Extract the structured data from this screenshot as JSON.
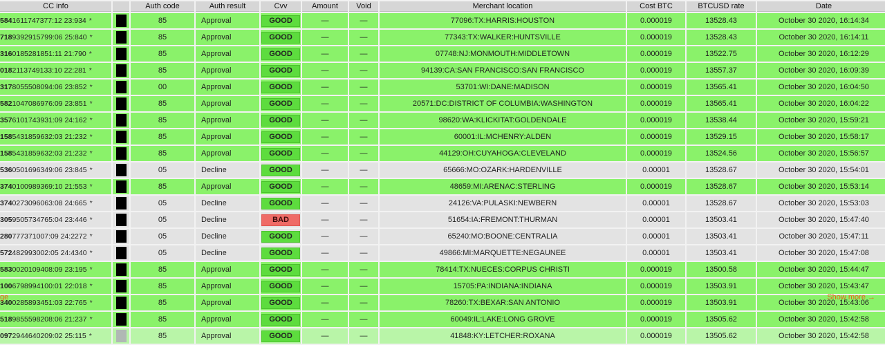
{
  "columns": [
    "CC info",
    "",
    "Auth code",
    "Auth result",
    "Cvv",
    "Amount",
    "Void",
    "Merchant location",
    "Cost BTC",
    "BTCUSD rate",
    "Date"
  ],
  "rows": [
    {
      "cc_prefix": "584",
      "cc_rest": "1611747377:12 23:934",
      "auth": "85",
      "result": "Approval",
      "cvv": "GOOD",
      "amount": "—",
      "void": "—",
      "location": "77096:TX:HARRIS:HOUSTON",
      "cost": "0.000019",
      "rate": "13528.43",
      "date": "October 30 2020, 16:14:34",
      "status": "ok"
    },
    {
      "cc_prefix": "718",
      "cc_rest": "9392915799:06 25:840",
      "auth": "85",
      "result": "Approval",
      "cvv": "GOOD",
      "amount": "—",
      "void": "—",
      "location": "77343:TX:WALKER:HUNTSVILLE",
      "cost": "0.000019",
      "rate": "13528.43",
      "date": "October 30 2020, 16:14:11",
      "status": "ok"
    },
    {
      "cc_prefix": "316",
      "cc_rest": "0185281851:11 21:790",
      "auth": "85",
      "result": "Approval",
      "cvv": "GOOD",
      "amount": "—",
      "void": "—",
      "location": "07748:NJ:MONMOUTH:MIDDLETOWN",
      "cost": "0.000019",
      "rate": "13522.75",
      "date": "October 30 2020, 16:12:29",
      "status": "ok"
    },
    {
      "cc_prefix": "018",
      "cc_rest": "2113749133:10 22:281",
      "auth": "85",
      "result": "Approval",
      "cvv": "GOOD",
      "amount": "—",
      "void": "—",
      "location": "94139:CA:SAN FRANCISCO:SAN FRANCISCO",
      "cost": "0.000019",
      "rate": "13557.37",
      "date": "October 30 2020, 16:09:39",
      "status": "ok"
    },
    {
      "cc_prefix": "317",
      "cc_rest": "8055508094:06 23:852",
      "auth": "00",
      "result": "Approval",
      "cvv": "GOOD",
      "amount": "—",
      "void": "—",
      "location": "53701:WI:DANE:MADISON",
      "cost": "0.000019",
      "rate": "13565.41",
      "date": "October 30 2020, 16:04:50",
      "status": "ok"
    },
    {
      "cc_prefix": "582",
      "cc_rest": "1047086976:09 23:851",
      "auth": "85",
      "result": "Approval",
      "cvv": "GOOD",
      "amount": "—",
      "void": "—",
      "location": "20571:DC:DISTRICT OF COLUMBIA:WASHINGTON",
      "cost": "0.000019",
      "rate": "13565.41",
      "date": "October 30 2020, 16:04:22",
      "status": "ok"
    },
    {
      "cc_prefix": "357",
      "cc_rest": "6101743931:09 24:162",
      "auth": "85",
      "result": "Approval",
      "cvv": "GOOD",
      "amount": "—",
      "void": "—",
      "location": "98620:WA:KLICKITAT:GOLDENDALE",
      "cost": "0.000019",
      "rate": "13538.44",
      "date": "October 30 2020, 15:59:21",
      "status": "ok"
    },
    {
      "cc_prefix": "158",
      "cc_rest": "5431859632:03 21:232",
      "auth": "85",
      "result": "Approval",
      "cvv": "GOOD",
      "amount": "—",
      "void": "—",
      "location": "60001:IL:MCHENRY:ALDEN",
      "cost": "0.000019",
      "rate": "13529.15",
      "date": "October 30 2020, 15:58:17",
      "status": "ok"
    },
    {
      "cc_prefix": "158",
      "cc_rest": "5431859632:03 21:232",
      "auth": "85",
      "result": "Approval",
      "cvv": "GOOD",
      "amount": "—",
      "void": "—",
      "location": "44129:OH:CUYAHOGA:CLEVELAND",
      "cost": "0.000019",
      "rate": "13524.56",
      "date": "October 30 2020, 15:56:57",
      "status": "ok"
    },
    {
      "cc_prefix": "536",
      "cc_rest": "0501696349:06 23:845",
      "auth": "05",
      "result": "Decline",
      "cvv": "GOOD",
      "amount": "—",
      "void": "—",
      "location": "65666:MO:OZARK:HARDENVILLE",
      "cost": "0.00001",
      "rate": "13528.67",
      "date": "October 30 2020, 15:54:01",
      "status": "decl"
    },
    {
      "cc_prefix": "374",
      "cc_rest": "0100989369:10 21:553",
      "auth": "85",
      "result": "Approval",
      "cvv": "GOOD",
      "amount": "—",
      "void": "—",
      "location": "48659:MI:ARENAC:STERLING",
      "cost": "0.000019",
      "rate": "13528.67",
      "date": "October 30 2020, 15:53:14",
      "status": "ok"
    },
    {
      "cc_prefix": "374",
      "cc_rest": "0273096063:08 24:665",
      "auth": "05",
      "result": "Decline",
      "cvv": "GOOD",
      "amount": "—",
      "void": "—",
      "location": "24126:VA:PULASKI:NEWBERN",
      "cost": "0.00001",
      "rate": "13528.67",
      "date": "October 30 2020, 15:53:03",
      "status": "decl"
    },
    {
      "cc_prefix": "305",
      "cc_rest": "9505734765:04 23:446",
      "auth": "05",
      "result": "Decline",
      "cvv": "BAD",
      "amount": "—",
      "void": "—",
      "location": "51654:IA:FREMONT:THURMAN",
      "cost": "0.00001",
      "rate": "13503.41",
      "date": "October 30 2020, 15:47:40",
      "status": "decl"
    },
    {
      "cc_prefix": "280",
      "cc_rest": "777371007:09 24:2272",
      "auth": "05",
      "result": "Decline",
      "cvv": "GOOD",
      "amount": "—",
      "void": "—",
      "location": "65240:MO:BOONE:CENTRALIA",
      "cost": "0.00001",
      "rate": "13503.41",
      "date": "October 30 2020, 15:47:11",
      "status": "decl"
    },
    {
      "cc_prefix": "572",
      "cc_rest": "482993002:05 24:4340",
      "auth": "05",
      "result": "Decline",
      "cvv": "GOOD",
      "amount": "—",
      "void": "—",
      "location": "49866:MI:MARQUETTE:NEGAUNEE",
      "cost": "0.00001",
      "rate": "13503.41",
      "date": "October 30 2020, 15:47:08",
      "status": "decl"
    },
    {
      "cc_prefix": "583",
      "cc_rest": "0020109408:09 23:195",
      "auth": "85",
      "result": "Approval",
      "cvv": "GOOD",
      "amount": "—",
      "void": "—",
      "location": "78414:TX:NUECES:CORPUS CHRISTI",
      "cost": "0.000019",
      "rate": "13500.58",
      "date": "October 30 2020, 15:44:47",
      "status": "ok"
    },
    {
      "cc_prefix": "100",
      "cc_rest": "6798994100:01 22:018",
      "auth": "85",
      "result": "Approval",
      "cvv": "GOOD",
      "amount": "—",
      "void": "—",
      "location": "15705:PA:INDIANA:INDIANA",
      "cost": "0.000019",
      "rate": "13503.91",
      "date": "October 30 2020, 15:43:47",
      "status": "ok"
    },
    {
      "cc_prefix": "340",
      "cc_rest": "0285893451:03 22:765",
      "auth": "85",
      "result": "Approval",
      "cvv": "GOOD",
      "amount": "—",
      "void": "—",
      "location": "78260:TX:BEXAR:SAN ANTONIO",
      "cost": "0.000019",
      "rate": "13503.91",
      "date": "October 30 2020, 15:43:06",
      "status": "ok"
    },
    {
      "cc_prefix": "518",
      "cc_rest": "9855598208:06 21:237",
      "auth": "85",
      "result": "Approval",
      "cvv": "GOOD",
      "amount": "—",
      "void": "—",
      "location": "60049:IL:LAKE:LONG GROVE",
      "cost": "0.000019",
      "rate": "13505.62",
      "date": "October 30 2020, 15:42:58",
      "status": "ok"
    },
    {
      "cc_prefix": "097",
      "cc_rest": "2944640209:02 25:115",
      "auth": "85",
      "result": "Approval",
      "cvv": "GOOD",
      "amount": "—",
      "void": "—",
      "location": "41848:KY:LETCHER:ROXANA",
      "cost": "0.000019",
      "rate": "13505.62",
      "date": "October 30 2020, 15:42:58",
      "status": "last"
    }
  ],
  "footer": {
    "prev_label": "ge",
    "more_label": "Show more →"
  },
  "colors": {
    "approval_row": "#8af26a",
    "decline_row": "#e3e3e3",
    "cvv_good": "#5ddc3e",
    "cvv_bad": "#ef6b66",
    "link": "#e8641b"
  }
}
